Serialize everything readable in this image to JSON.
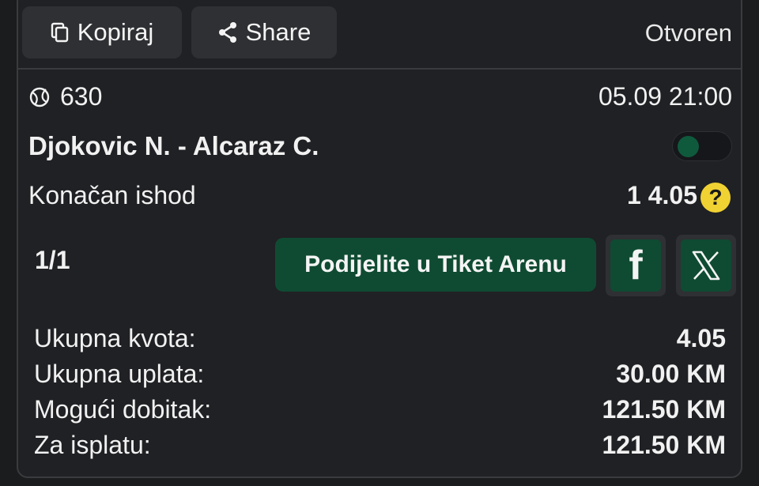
{
  "header": {
    "copy_label": "Kopiraj",
    "share_label": "Share",
    "status": "Otvoren"
  },
  "event": {
    "code": "630",
    "datetime": "05.09 21:00",
    "match": "Djokovic N. - Alcaraz C.",
    "market": "Konačan ishod",
    "selection": "1 4.05",
    "help_symbol": "?"
  },
  "share": {
    "pages": "1/1",
    "arena_label": "Podijelite u Tiket Arenu",
    "facebook_letter": "f"
  },
  "summary": [
    {
      "label": "Ukupna kvota:",
      "value": "4.05"
    },
    {
      "label": "Ukupna uplata:",
      "value": "30.00 KM"
    },
    {
      "label": "Mogući dobitak:",
      "value": "121.50 KM"
    },
    {
      "label": "Za isplatu:",
      "value": "121.50 KM"
    }
  ],
  "icons": {
    "copy": "copy-icon",
    "share": "share-icon",
    "sport": "tennis-ball-icon",
    "facebook": "facebook-icon",
    "x": "x-icon"
  },
  "colors": {
    "background": "#202124",
    "button": "#2f3033",
    "accent_green": "#0f4b32",
    "help_yellow": "#f0d233"
  }
}
